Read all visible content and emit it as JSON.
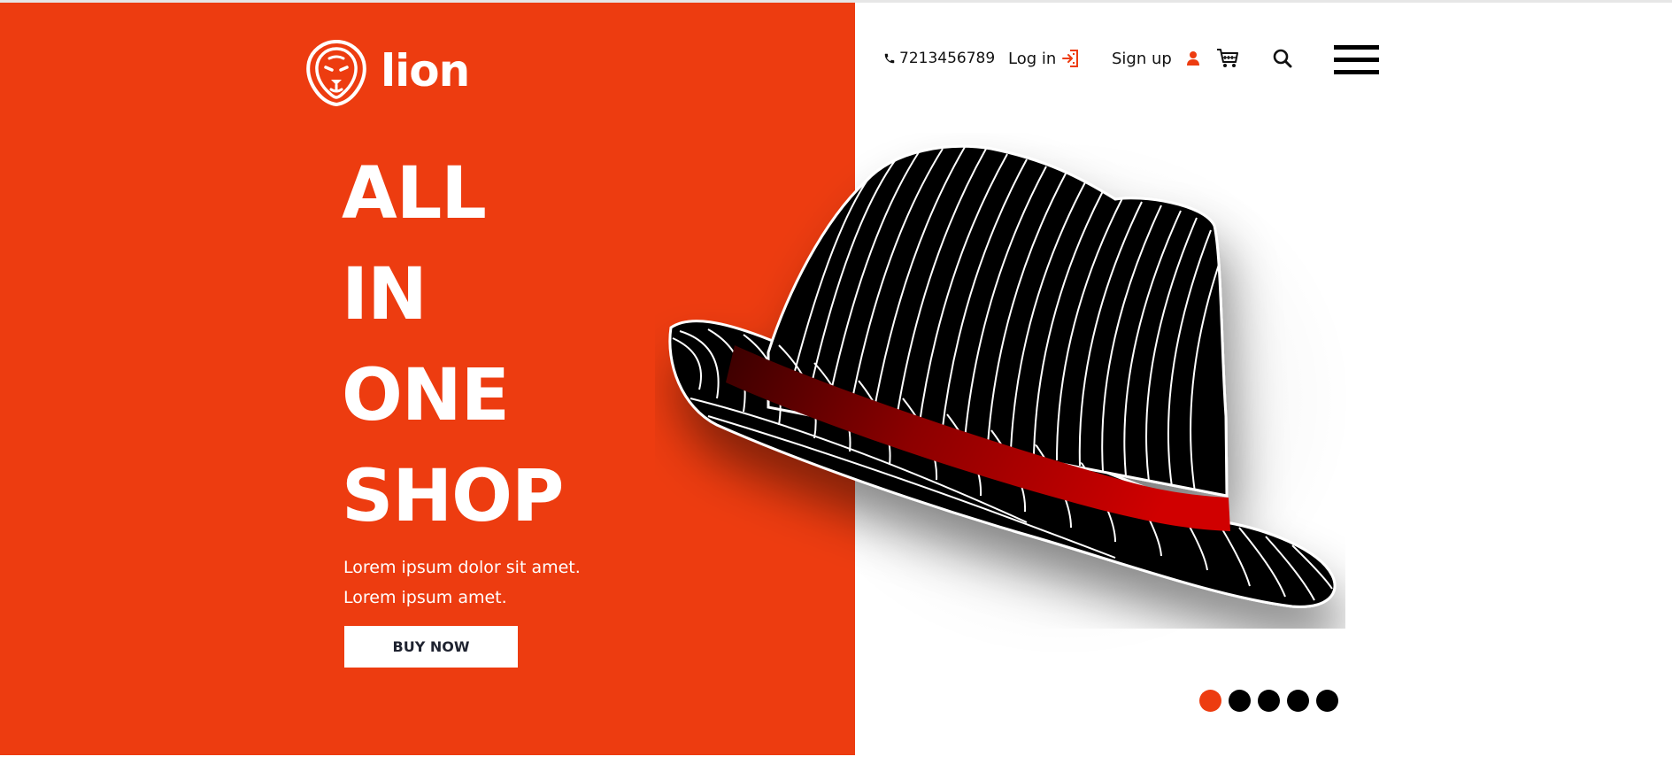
{
  "brand": {
    "name": "lion",
    "logo_icon": "lion-head-icon"
  },
  "nav": {
    "phone": {
      "icon": "phone-icon",
      "number": "7213456789"
    },
    "login": {
      "label": "Log in",
      "icon": "login-icon"
    },
    "signup": {
      "label": "Sign up",
      "icon": "user-icon"
    },
    "cart": {
      "icon": "cart-icon"
    },
    "search": {
      "icon": "search-icon"
    },
    "menu": {
      "icon": "hamburger-menu-icon"
    }
  },
  "hero": {
    "headline": [
      "ALL",
      "IN",
      "ONE",
      "SHOP"
    ],
    "tagline": [
      "Lorem ipsum dolor sit amet.",
      "Lorem ipsum amet."
    ],
    "cta_label": "BUY NOW",
    "product_image": "fedora-hat"
  },
  "slider": {
    "total": 5,
    "active": 1
  },
  "colors": {
    "accent": "#ed3c10",
    "text_dark": "#1f2330",
    "background": "#ffffff",
    "hat_band": "#c40000"
  }
}
